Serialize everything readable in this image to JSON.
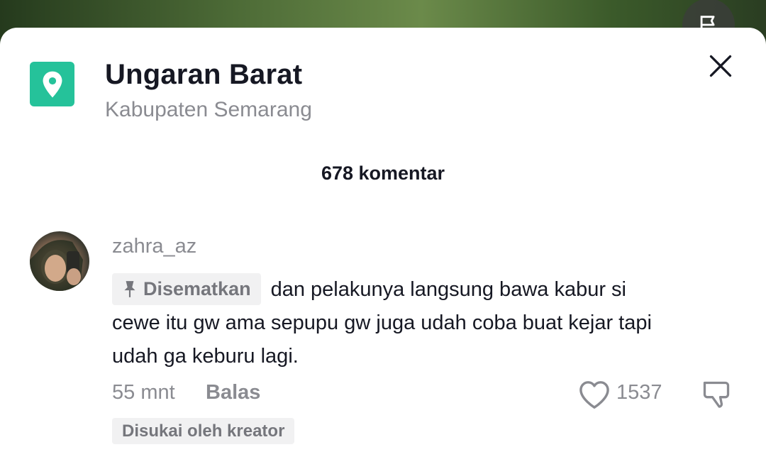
{
  "location": {
    "title": "Ungaran Barat",
    "subtitle": "Kabupaten Semarang",
    "icon": "location-pin-icon",
    "icon_color": "#25c29a"
  },
  "header": {
    "comment_count_label": "678 komentar"
  },
  "comment": {
    "username": "zahra_az",
    "pinned_label": "Disematkan",
    "text": "dan pelakunya langsung bawa kabur si cewe itu gw ama sepupu gw juga udah coba buat kejar tapi udah ga keburu lagi.",
    "time": "55 mnt",
    "reply_label": "Balas",
    "like_count": "1537",
    "creator_liked_label": "Disukai oleh kreator"
  },
  "colors": {
    "text_primary": "#161823",
    "text_secondary": "#8a8b91",
    "chip_bg": "#f1f1f2"
  }
}
